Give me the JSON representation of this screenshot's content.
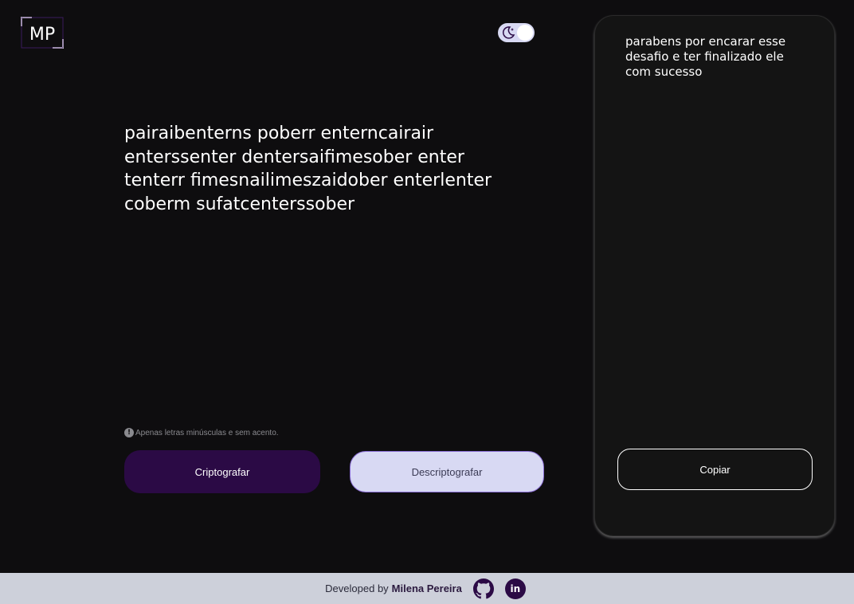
{
  "logo": {
    "text": "MP"
  },
  "theme_toggle": {
    "icon": "moon-icon"
  },
  "input": {
    "value": "pairaibenterns poberr enterncairair enterssenter dentersaifimesober enter tenterr fimesnailimeszaidober enterlenter coberm sufatcenterssober"
  },
  "hint": {
    "text": "Apenas letras minúsculas e sem acento."
  },
  "buttons": {
    "encrypt": "Criptografar",
    "decrypt": "Descriptografar"
  },
  "output": {
    "text": "parabens por encarar esse desafio e ter finalizado ele com sucesso",
    "copy_label": "Copiar"
  },
  "footer": {
    "prefix": "Developed by",
    "author": "Milena Pereira",
    "icons": [
      "github-icon",
      "linkedin-icon"
    ],
    "linkedin_text": "in"
  },
  "colors": {
    "background": "#0e0d0f",
    "accent": "#2b0a45",
    "secondary_button": "#d8d9f3",
    "footer": "#cdd0da"
  }
}
